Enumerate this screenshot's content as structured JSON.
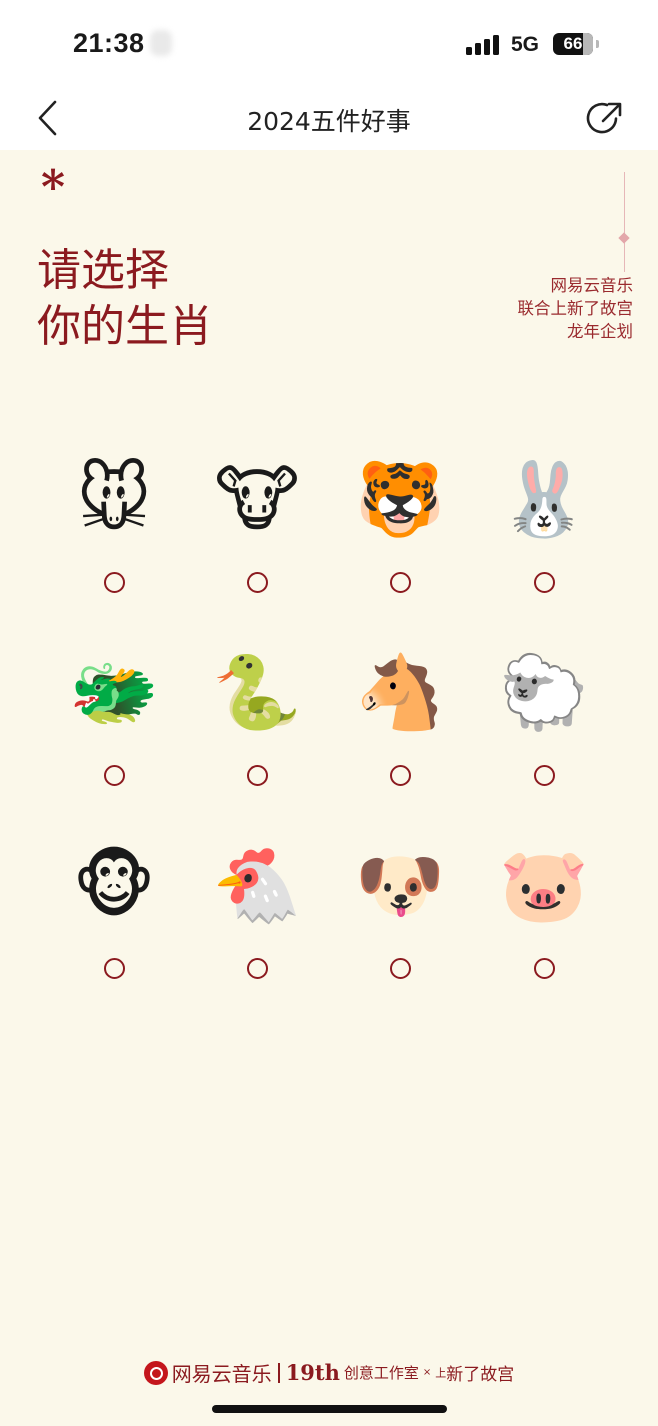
{
  "status_bar": {
    "time": "21:38",
    "network": "5G",
    "battery": "66"
  },
  "nav": {
    "title": "2024五件好事",
    "back_icon": "chevron-left-icon",
    "share_icon": "share-icon"
  },
  "hero": {
    "mark": "*",
    "headline_line1": "请选择",
    "headline_line2": "你的生肖",
    "brand_line1": "网易云音乐",
    "brand_line2": "联合上新了故宫",
    "brand_line3": "龙年企划"
  },
  "zodiac_options": [
    {
      "emoji": "🐭",
      "selected": false
    },
    {
      "emoji": "🐮",
      "selected": false
    },
    {
      "emoji": "🐯",
      "selected": false
    },
    {
      "emoji": "🐰",
      "selected": false
    },
    {
      "emoji": "🐲",
      "selected": false
    },
    {
      "emoji": "🐍",
      "selected": false
    },
    {
      "emoji": "🐴",
      "selected": false
    },
    {
      "emoji": "🐑",
      "selected": false
    },
    {
      "emoji": "🐵",
      "selected": false
    },
    {
      "emoji": "🐔",
      "selected": false
    },
    {
      "emoji": "🐶",
      "selected": false
    },
    {
      "emoji": "🐷",
      "selected": false
    }
  ],
  "footer": {
    "brand": "网易云音乐",
    "studio_number": "19th",
    "studio": "创意工作室",
    "cross": "×",
    "partner_small": "上",
    "partner": "新了故宫"
  },
  "colors": {
    "accent": "#8b1a1f",
    "background": "#fbf8ea",
    "brand_red": "#c4161c"
  }
}
